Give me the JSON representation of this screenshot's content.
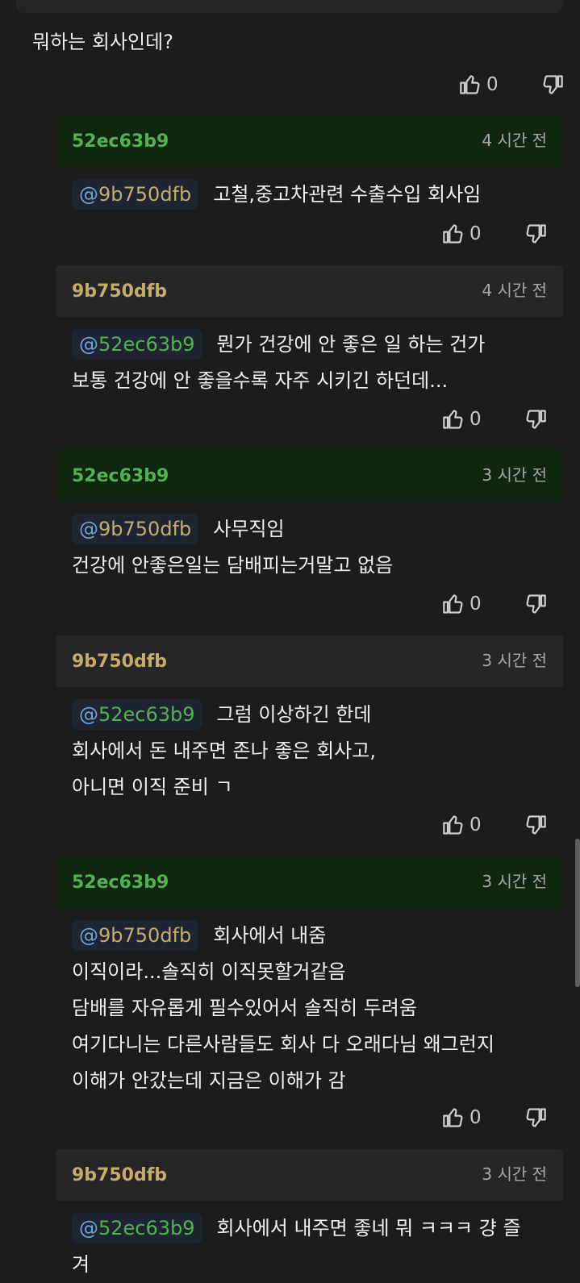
{
  "parent": {
    "text": "뭐하는 회사인데?",
    "likes": "0"
  },
  "replies": [
    {
      "author": "52ec63b9",
      "time": "4 시간 전",
      "mention_at": "@",
      "mention_name": "9b750dfb",
      "lines": [
        "고철,중고차관련 수출수입 회사임"
      ],
      "likes": "0"
    },
    {
      "author": "9b750dfb",
      "time": "4 시간 전",
      "mention_at": "@",
      "mention_name": "52ec63b9",
      "lines": [
        "뭔가 건강에 안 좋은 일 하는 건가",
        "보통 건강에 안 좋을수록 자주 시키긴 하던데..."
      ],
      "likes": "0"
    },
    {
      "author": "52ec63b9",
      "time": "3 시간 전",
      "mention_at": "@",
      "mention_name": "9b750dfb",
      "lines": [
        "사무직임",
        "건강에 안좋은일는 담배피는거말고 없음"
      ],
      "likes": "0"
    },
    {
      "author": "9b750dfb",
      "time": "3 시간 전",
      "mention_at": "@",
      "mention_name": "52ec63b9",
      "lines": [
        "그럼 이상하긴 한데",
        "회사에서 돈 내주면 존나 좋은 회사고,",
        "아니면 이직 준비 ㄱ"
      ],
      "likes": "0"
    },
    {
      "author": "52ec63b9",
      "time": "3 시간 전",
      "mention_at": "@",
      "mention_name": "9b750dfb",
      "lines": [
        "회사에서 내줌",
        "이직이라...솔직히 이직못할거같음",
        "담배를 자유롭게 필수있어서 솔직히 두려움",
        "여기다니는 다른사람들도 회사 다 오래다님 왜그런지",
        "이해가 안갔는데 지금은 이해가 감"
      ],
      "likes": "0"
    },
    {
      "author": "9b750dfb",
      "time": "3 시간 전",
      "mention_at": "@",
      "mention_name": "52ec63b9",
      "lines": [
        "회사에서 내주면 좋네 뭐 ㅋㅋㅋ 걍 즐",
        "겨"
      ],
      "likes": ""
    }
  ],
  "icons": {
    "like": "thumb-up-icon",
    "dislike": "thumb-down-icon"
  },
  "colors": {
    "background": "#1c1c1c",
    "op_header": "#0f260f",
    "other_header": "#262626",
    "op_name": "#4fb34f",
    "other_name": "#c6ac6b",
    "mention_at": "#6ea4d8"
  }
}
